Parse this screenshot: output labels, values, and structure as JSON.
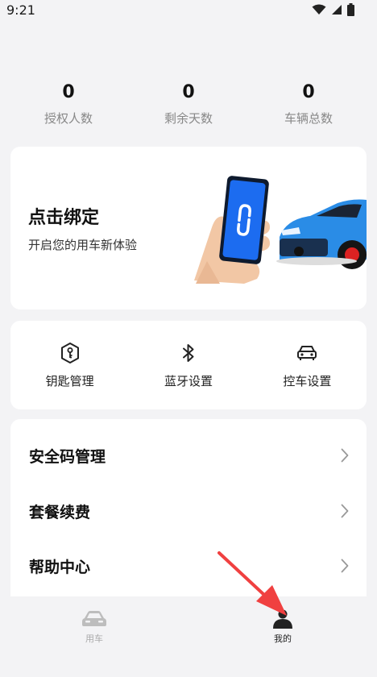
{
  "status_bar": {
    "time": "9:21",
    "icons": [
      "wifi-icon",
      "signal-icon",
      "battery-icon"
    ]
  },
  "stats": [
    {
      "value": "0",
      "label": "授权人数"
    },
    {
      "value": "0",
      "label": "剩余天数"
    },
    {
      "value": "0",
      "label": "车辆总数"
    }
  ],
  "bind_card": {
    "title": "点击绑定",
    "subtitle": "开启您的用车新体验",
    "illustration_icons": [
      "hand-holding-phone-icon",
      "link-icon",
      "blue-car-icon"
    ],
    "colors": {
      "phone": "#1c6cf0",
      "car": "#2a8ce6",
      "hand": "#f2c7a5"
    }
  },
  "quick_actions": [
    {
      "label": "钥匙管理",
      "icon": "key-shield-icon"
    },
    {
      "label": "蓝牙设置",
      "icon": "bluetooth-icon"
    },
    {
      "label": "控车设置",
      "icon": "car-front-icon"
    }
  ],
  "menu": [
    {
      "label": "安全码管理",
      "icon": "chevron-right-icon"
    },
    {
      "label": "套餐续费",
      "icon": "chevron-right-icon"
    },
    {
      "label": "帮助中心",
      "icon": "chevron-right-icon"
    }
  ],
  "tabbar": [
    {
      "label": "用车",
      "icon": "car-icon",
      "active": false
    },
    {
      "label": "我的",
      "icon": "person-icon",
      "active": true
    }
  ],
  "annotation": {
    "icon": "red-arrow-icon",
    "color": "#f04040"
  }
}
